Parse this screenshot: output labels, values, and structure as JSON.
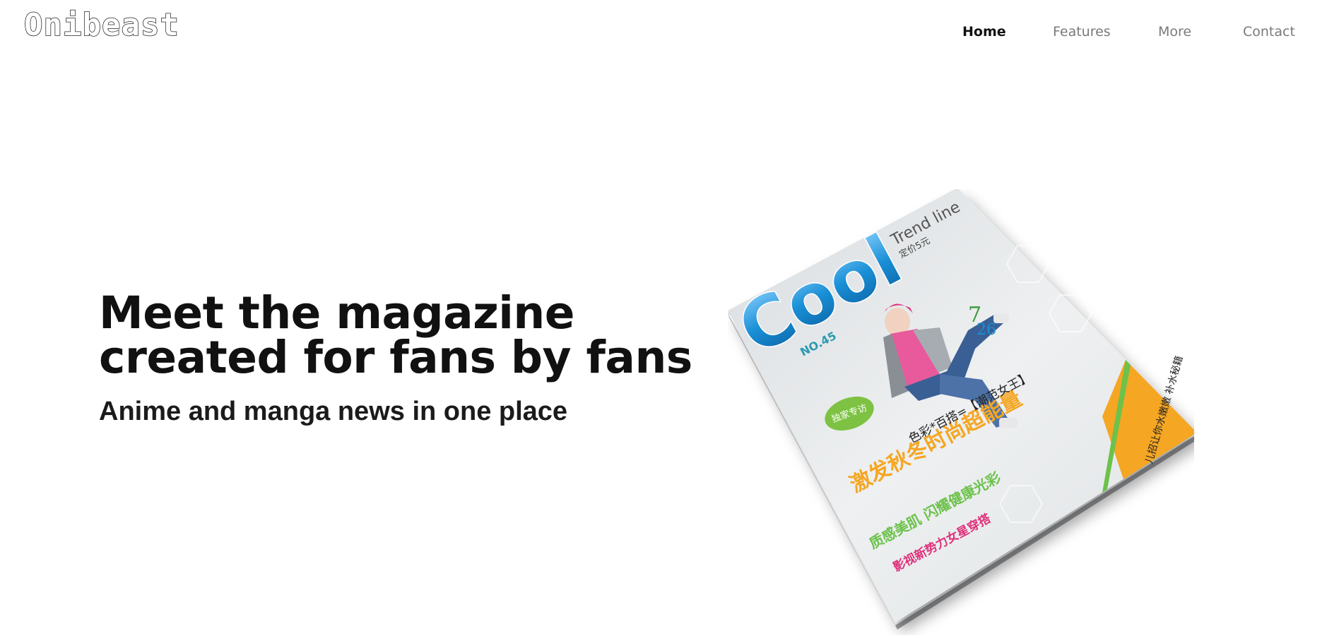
{
  "header": {
    "logo_text": "Onibeast",
    "nav": [
      {
        "label": "Home",
        "active": true
      },
      {
        "label": "Features",
        "active": false
      },
      {
        "label": "More",
        "active": false
      },
      {
        "label": "Contact",
        "active": false
      }
    ]
  },
  "hero": {
    "title_line1": "Meet the magazine",
    "title_line2": "created for fans by fans",
    "subtitle": "Anime and manga news in one place"
  },
  "magazine_cover": {
    "masthead": "Cool",
    "issue": "NO.45",
    "tagline": "Trend line",
    "price": "定价5元",
    "headline_1": "激发秋冬时尚超能量",
    "headline_2": "色彩*百搭=【潮范女王】",
    "headline_3": "质感美肌 闪耀健康光彩",
    "headline_4": "影视新势力女星穿搭",
    "feature_big_1": "7",
    "feature_big_2": "26",
    "badge": "独家专访",
    "side_strip": "儿招让你水嫩嫩 补水秘籍",
    "accent_blue": "#1a8fd6",
    "accent_green": "#6cc24a",
    "accent_orange": "#f5a623"
  }
}
